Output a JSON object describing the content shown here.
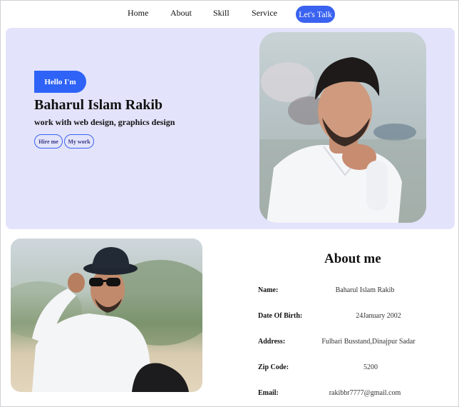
{
  "nav": {
    "links": [
      "Home",
      "About",
      "Skill",
      "Service"
    ],
    "cta": "Let's Talk"
  },
  "hero": {
    "badge": "Hello I'm",
    "name": "Baharul Islam Rakib",
    "subtitle": "work with web design, graphics design",
    "buttons": [
      "Hire me",
      "My work"
    ]
  },
  "about": {
    "title": "About me",
    "rows": [
      {
        "label": "Name:",
        "value": "Baharul Islam Rakib"
      },
      {
        "label": "Date Of Birth:",
        "value": "24January 2002"
      },
      {
        "label": "Address:",
        "value": "Fulbari Busstand,Dinajpur Sadar"
      },
      {
        "label": "Zip Code:",
        "value": "5200"
      },
      {
        "label": "Email:",
        "value": "rakibbr7777@gmail.com"
      }
    ]
  },
  "colors": {
    "accent": "#3a62f0",
    "hero_bg": "#e3e4fb"
  }
}
